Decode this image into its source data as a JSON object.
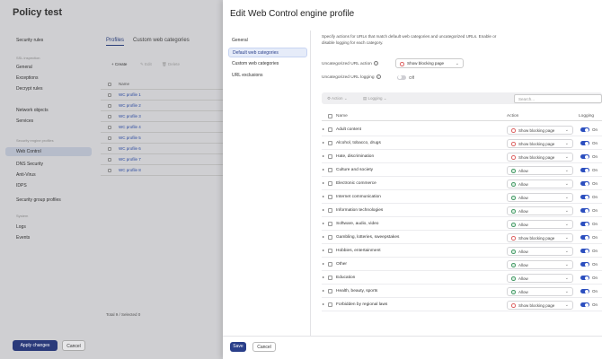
{
  "background": {
    "title": "Policy test",
    "sidebar": [
      {
        "label": "Security rules",
        "type": "item"
      },
      {
        "label": "SSL inspection",
        "type": "section"
      },
      {
        "label": "General",
        "type": "item"
      },
      {
        "label": "Exceptions",
        "type": "item"
      },
      {
        "label": "Decrypt rules",
        "type": "item"
      },
      {
        "label": "Network objects",
        "type": "item"
      },
      {
        "label": "Services",
        "type": "item"
      },
      {
        "label": "Security engine profiles",
        "type": "section"
      },
      {
        "label": "Web Control",
        "type": "item",
        "active": true
      },
      {
        "label": "DNS Security",
        "type": "item"
      },
      {
        "label": "Anti-Virus",
        "type": "item"
      },
      {
        "label": "IDPS",
        "type": "item"
      },
      {
        "label": "Security group profiles",
        "type": "item"
      },
      {
        "label": "System",
        "type": "section"
      },
      {
        "label": "Logs",
        "type": "item"
      },
      {
        "label": "Events",
        "type": "item"
      }
    ],
    "tabs": [
      "Profiles",
      "Custom web categories"
    ],
    "toolbar": [
      "+ Create",
      "✎ Edit",
      "🗑 Delete"
    ],
    "table_header": "Name",
    "profiles": [
      "WC profile 1",
      "WC profile 2",
      "WC profile 3",
      "WC profile 4",
      "WC profile 5",
      "WC profile 6",
      "WC profile 7",
      "WC profile 8"
    ],
    "total": "Total 9 / Selected 0",
    "apply_label": "Apply changes",
    "cancel_label": "Cancel"
  },
  "drawer": {
    "title": "Edit Web Control engine profile",
    "nav": [
      {
        "label": "General"
      },
      {
        "label": "Default web categories",
        "active": true
      },
      {
        "label": "Custom web categories"
      },
      {
        "label": "URL exclusions"
      }
    ],
    "description": "Specify actions for URLs that match default web categories and uncategorized URLs. Enable or disable logging for each category.",
    "uncat_action_label": "Uncategorized URL action",
    "uncat_action_value": "Show blocking page",
    "uncat_logging_label": "Uncategorized URL logging",
    "uncat_logging_value": "Off",
    "uncat_logging_on": false,
    "toolbar_action": "Action",
    "toolbar_logging": "Logging",
    "search_placeholder": "Search...",
    "col_name": "Name",
    "col_action": "Action",
    "col_logging": "Logging",
    "rows": [
      {
        "name": "Adult content",
        "action": "Show blocking page",
        "status": "block",
        "logging": "On"
      },
      {
        "name": "Alcohol, tobacco, drugs",
        "action": "Show blocking page",
        "status": "block",
        "logging": "On"
      },
      {
        "name": "Hate, discrimination",
        "action": "Show blocking page",
        "status": "block",
        "logging": "On"
      },
      {
        "name": "Culture and society",
        "action": "Allow",
        "status": "allow",
        "logging": "On"
      },
      {
        "name": "Electronic commerce",
        "action": "Allow",
        "status": "allow",
        "logging": "On"
      },
      {
        "name": "Internet communication",
        "action": "Allow",
        "status": "allow",
        "logging": "On"
      },
      {
        "name": "Information technologies",
        "action": "Allow",
        "status": "allow",
        "logging": "On"
      },
      {
        "name": "Software, audio, video",
        "action": "Allow",
        "status": "allow",
        "logging": "On"
      },
      {
        "name": "Gambling, lotteries, sweepstakes",
        "action": "Show blocking page",
        "status": "block",
        "logging": "On"
      },
      {
        "name": "Hobbies, entertainment",
        "action": "Allow",
        "status": "allow",
        "logging": "On"
      },
      {
        "name": "Other",
        "action": "Allow",
        "status": "allow",
        "logging": "On"
      },
      {
        "name": "Education",
        "action": "Allow",
        "status": "allow",
        "logging": "On"
      },
      {
        "name": "Health, beauty, sports",
        "action": "Allow",
        "status": "allow",
        "logging": "On"
      },
      {
        "name": "Forbidden by regional laws",
        "action": "Show blocking page",
        "status": "block",
        "logging": "On"
      }
    ],
    "save_label": "Save",
    "cancel_label": "Cancel"
  },
  "colors": {
    "accent": "#2c4fbf",
    "primary_button": "#2a3f8a",
    "block": "#d66666",
    "allow": "#4a9c6a"
  }
}
